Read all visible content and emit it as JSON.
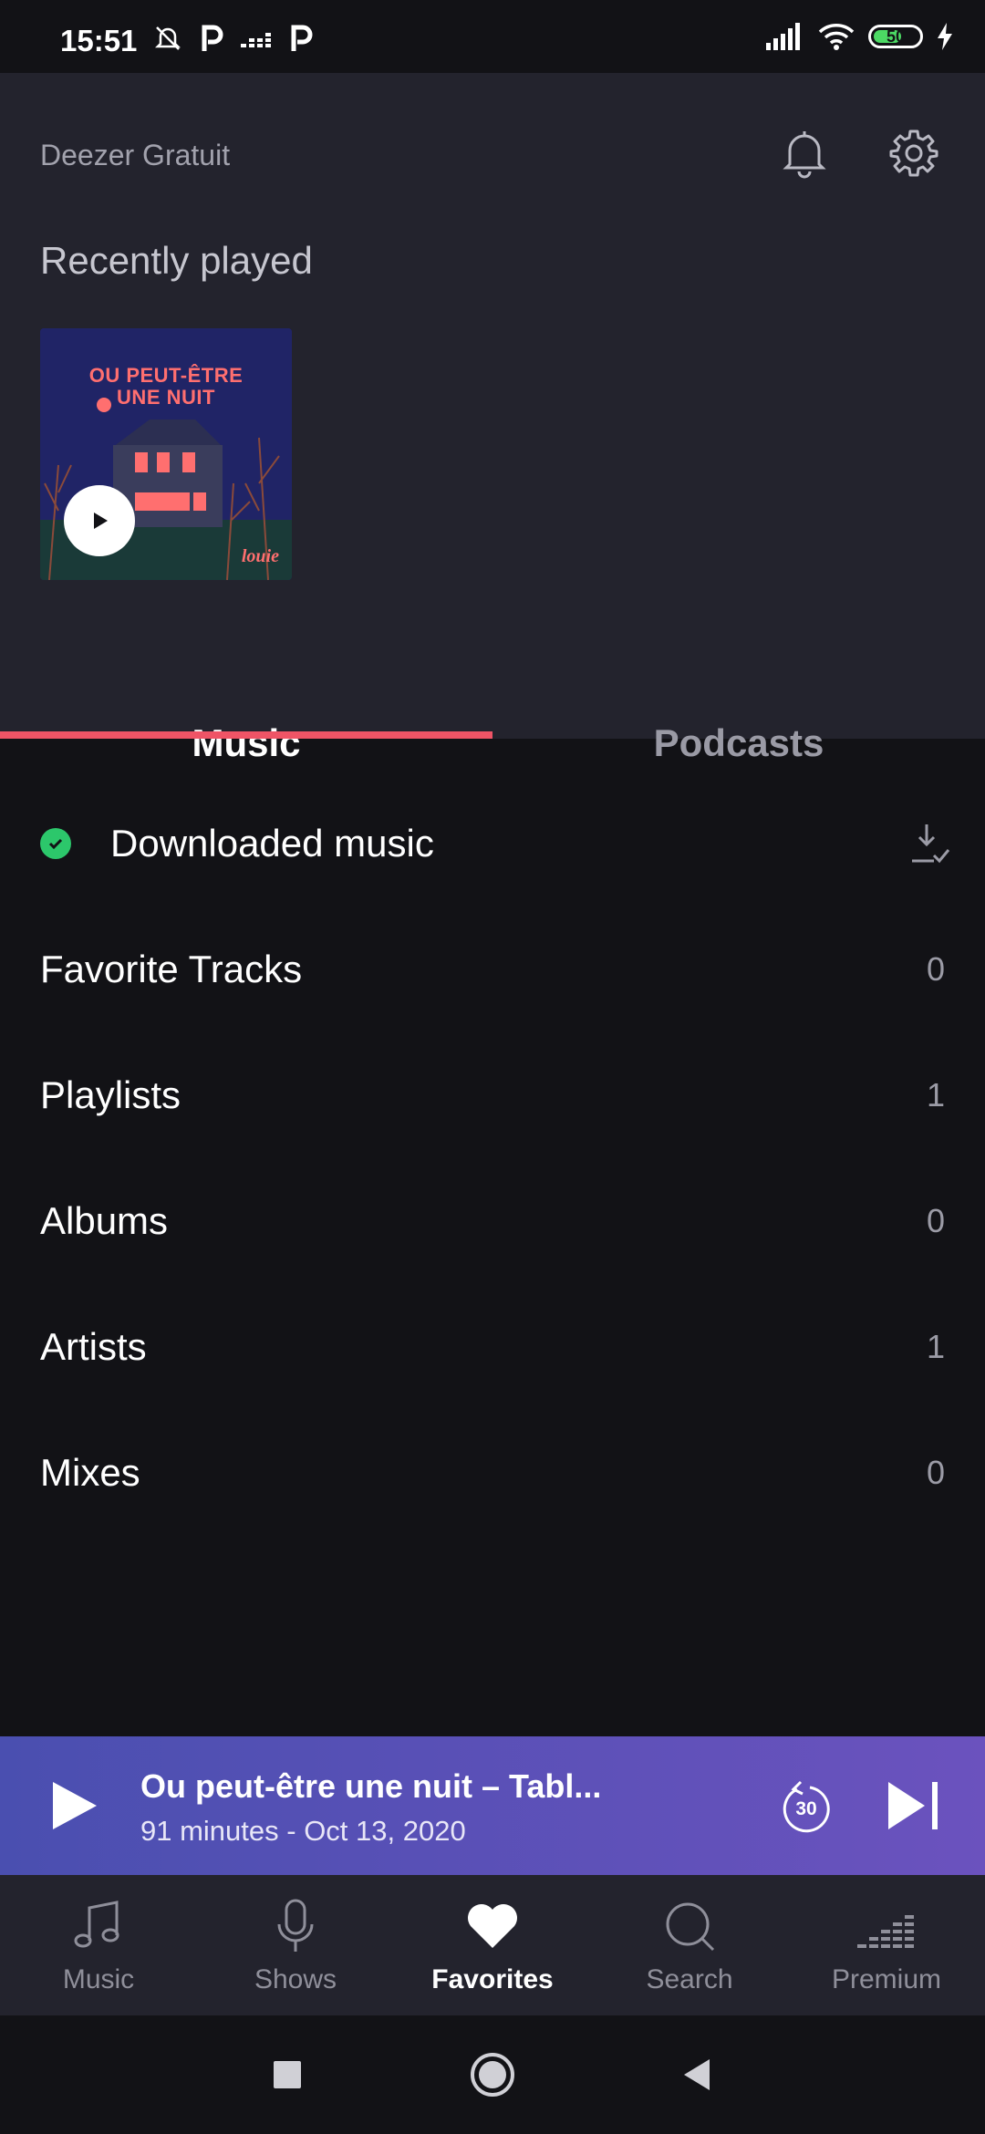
{
  "status": {
    "time": "15:51",
    "battery": "50",
    "colors": {
      "battery_fill": "#4cd964"
    }
  },
  "header": {
    "app_title": "Deezer Gratuit",
    "icons": [
      "bell-icon",
      "gear-icon"
    ]
  },
  "recently_played": {
    "title": "Recently played",
    "album": {
      "cover_title": "OU PEUT-ÊTRE\nUNE NUIT",
      "cover_artist": "louie"
    }
  },
  "tabs": [
    {
      "label": "Music",
      "active": true
    },
    {
      "label": "Podcasts",
      "active": false
    }
  ],
  "library": {
    "downloaded": {
      "label": "Downloaded music",
      "icon": "download-check-icon"
    },
    "rows": [
      {
        "label": "Favorite Tracks",
        "count": "0"
      },
      {
        "label": "Playlists",
        "count": "1"
      },
      {
        "label": "Albums",
        "count": "0"
      },
      {
        "label": "Artists",
        "count": "1"
      },
      {
        "label": "Mixes",
        "count": "0"
      }
    ]
  },
  "player": {
    "title": "Ou peut-être une nuit – Tabl...",
    "subtitle": "91 minutes - Oct 13, 2020",
    "rewind_label": "30"
  },
  "nav": [
    {
      "label": "Music",
      "icon": "music-note-icon",
      "active": false
    },
    {
      "label": "Shows",
      "icon": "microphone-icon",
      "active": false
    },
    {
      "label": "Favorites",
      "icon": "heart-icon",
      "active": true
    },
    {
      "label": "Search",
      "icon": "search-icon",
      "active": false
    },
    {
      "label": "Premium",
      "icon": "equalizer-icon",
      "active": false
    }
  ],
  "colors": {
    "accent": "#ef5466",
    "background": "#121216",
    "surface": "#23232d",
    "success": "#2cc76b"
  }
}
